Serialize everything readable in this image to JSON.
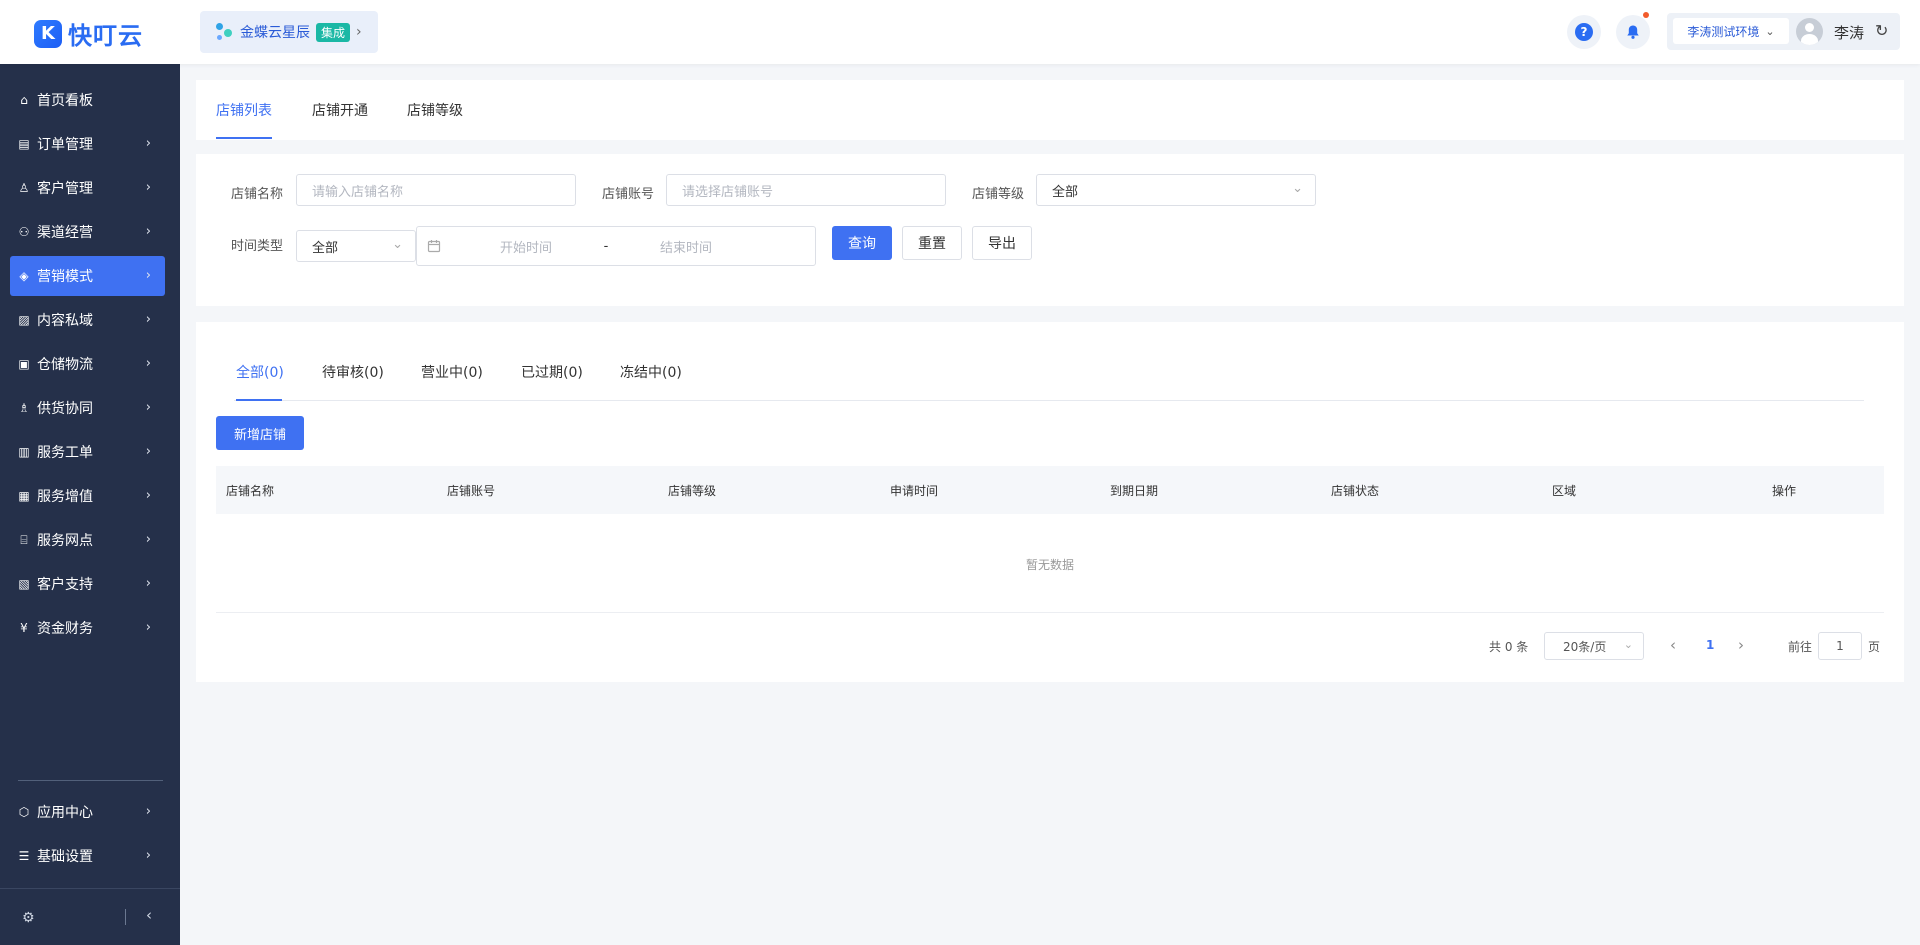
{
  "header": {
    "logo_mark": "K",
    "logo_text": "快叮云",
    "integration_label": "金蝶云星辰",
    "integration_badge": "集成",
    "env_label": "李涛测试环境",
    "user_name": "李涛"
  },
  "sidebar": {
    "items": [
      {
        "label": "首页看板",
        "icon": "home-icon",
        "glyph": "⌂",
        "has_arrow": false
      },
      {
        "label": "订单管理",
        "icon": "clipboard-icon",
        "glyph": "▤",
        "has_arrow": true
      },
      {
        "label": "客户管理",
        "icon": "user-icon",
        "glyph": "♙",
        "has_arrow": true
      },
      {
        "label": "渠道经营",
        "icon": "network-icon",
        "glyph": "⚇",
        "has_arrow": true
      },
      {
        "label": "营销模式",
        "icon": "tag-icon",
        "glyph": "◈",
        "has_arrow": true,
        "active": true
      },
      {
        "label": "内容私域",
        "icon": "image-icon",
        "glyph": "▨",
        "has_arrow": true
      },
      {
        "label": "仓储物流",
        "icon": "box-icon",
        "glyph": "▣",
        "has_arrow": true
      },
      {
        "label": "供货协同",
        "icon": "user-group-icon",
        "glyph": "♗",
        "has_arrow": true
      },
      {
        "label": "服务工单",
        "icon": "ticket-icon",
        "glyph": "▥",
        "has_arrow": true
      },
      {
        "label": "服务增值",
        "icon": "bag-icon",
        "glyph": "▦",
        "has_arrow": true
      },
      {
        "label": "服务网点",
        "icon": "store-icon",
        "glyph": "⌸",
        "has_arrow": true
      },
      {
        "label": "客户支持",
        "icon": "support-icon",
        "glyph": "▧",
        "has_arrow": true
      },
      {
        "label": "资金财务",
        "icon": "yuan-icon",
        "glyph": "¥",
        "has_arrow": true
      }
    ],
    "bottom_items": [
      {
        "label": "应用中心",
        "icon": "cube-icon",
        "glyph": "⬡"
      },
      {
        "label": "基础设置",
        "icon": "sliders-icon",
        "glyph": "☰"
      }
    ]
  },
  "top_tabs": [
    "店铺列表",
    "店铺开通",
    "店铺等级"
  ],
  "filter": {
    "store_name_label": "店铺名称",
    "store_name_placeholder": "请输入店铺名称",
    "store_account_label": "店铺账号",
    "store_account_placeholder": "请选择店铺账号",
    "store_level_label": "店铺等级",
    "store_level_value": "全部",
    "time_type_label": "时间类型",
    "time_type_value": "全部",
    "start_placeholder": "开始时间",
    "range_sep": "-",
    "end_placeholder": "结束时间",
    "query_btn": "查询",
    "reset_btn": "重置",
    "export_btn": "导出"
  },
  "status_tabs": [
    "全部(0)",
    "待审核(0)",
    "营业中(0)",
    "已过期(0)",
    "冻结中(0)"
  ],
  "add_btn": "新增店铺",
  "table": {
    "columns": [
      "店铺名称",
      "店铺账号",
      "店铺等级",
      "申请时间",
      "到期日期",
      "店铺状态",
      "区域",
      "操作"
    ],
    "empty_text": "暂无数据"
  },
  "pagination": {
    "total": "共 0 条",
    "page_size": "20条/页",
    "current_page": "1",
    "goto_label": "前往",
    "goto_value": "1",
    "page_suffix": "页"
  },
  "colors": {
    "primary": "#3f71f2",
    "sidebar_bg": "#25304a",
    "badge": "#1bb8a5",
    "notification_dot": "#f25b2b"
  }
}
